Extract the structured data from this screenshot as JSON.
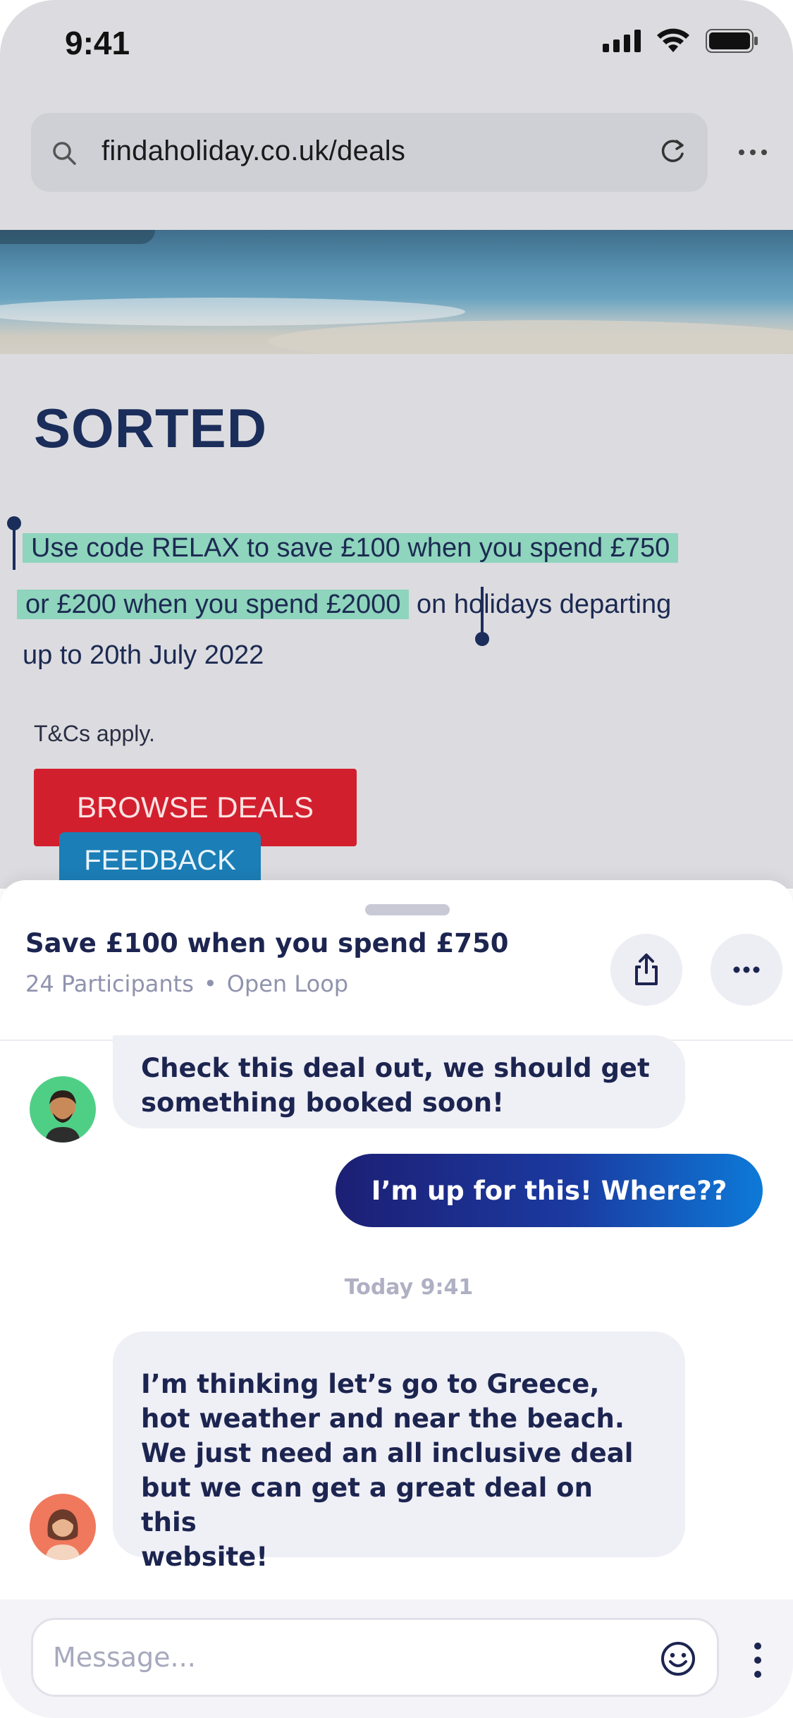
{
  "status_bar": {
    "time": "9:41",
    "icons": [
      "cellular-signal-icon",
      "wifi-icon",
      "battery-icon"
    ]
  },
  "browser": {
    "url": "findaholiday.co.uk/deals",
    "icons": [
      "search-icon",
      "reload-icon",
      "more-horizontal-icon"
    ]
  },
  "page": {
    "heading": "SORTED",
    "promo": {
      "line1_selected": "Use code RELAX to save £100 when you spend £750",
      "line2_selected": "or £200 when you spend £2000",
      "line2_rest": "on holidays departing",
      "line3": "up to 20th July 2022"
    },
    "terms": "T&Cs apply.",
    "browse_button": "BROWSE DEALS",
    "feedback_button": "FEEDBACK",
    "colors": {
      "highlight": "#8fd4bd",
      "browse_button": "#d21f2e",
      "feedback_button": "#1b7eb6",
      "heading": "#1b2d5a"
    }
  },
  "chat": {
    "title": "Save £100 when you spend £750",
    "participants": "24 Participants",
    "separator": "•",
    "loop_type": "Open Loop",
    "messages": [
      {
        "direction": "incoming",
        "avatar": "avatar-man-green",
        "lines": [
          "Check this deal out, we should get",
          "something booked soon!"
        ]
      },
      {
        "direction": "outgoing",
        "text": "I’m up for this! Where??"
      },
      {
        "direction": "timestamp",
        "text": "Today 9:41"
      },
      {
        "direction": "incoming",
        "avatar": "avatar-woman-orange",
        "lines": [
          "I’m thinking let’s go to Greece,",
          "hot weather and near the beach.",
          "We just need an all inclusive deal",
          "but we can get a great deal on this",
          "website!"
        ]
      }
    ],
    "composer_placeholder": "Message...",
    "icons": [
      "share-icon",
      "more-horizontal-icon",
      "emoji-icon",
      "more-vertical-icon"
    ],
    "colors": {
      "outgoing_gradient_start": "#1c1f74",
      "outgoing_gradient_end": "#0d7ad8",
      "incoming_bubble": "#efeff6"
    }
  }
}
